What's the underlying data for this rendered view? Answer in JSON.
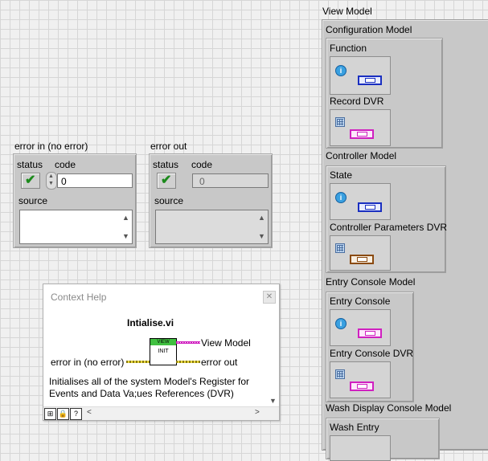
{
  "error_in": {
    "label": "error in (no error)",
    "status_label": "status",
    "code_label": "code",
    "code_value": "0",
    "source_label": "source"
  },
  "error_out": {
    "label": "error out",
    "status_label": "status",
    "code_label": "code",
    "code_value": "0",
    "source_label": "source"
  },
  "view_model": {
    "label": "View Model",
    "sections": [
      {
        "title": "Configuration Model",
        "items": [
          "Function",
          "Record DVR"
        ]
      },
      {
        "title": "Controller Model",
        "items": [
          "State",
          "Controller Parameters DVR"
        ]
      },
      {
        "title": "Entry Console Model",
        "items": [
          "Entry Console",
          "Entry Console DVR"
        ]
      },
      {
        "title": "Wash Display Console Model",
        "items": [
          "Wash Entry"
        ]
      }
    ]
  },
  "context_help": {
    "title": "Context Help",
    "vi_name": "Intialise.vi",
    "vi_icon_top": "VIEW",
    "vi_icon_text": "INIT",
    "output_label": "View Model",
    "input_label": "error in (no error)",
    "error_out_label": "error out",
    "description": "Initialises all of the system Model's Register for Events and Data Va;ues References (DVR)"
  },
  "colors": {
    "status_ok": "#1c8a1c",
    "enum_wire": "#1a2fc0",
    "refnum_wire": "#d020c0",
    "error_wire": "#e8d840"
  }
}
